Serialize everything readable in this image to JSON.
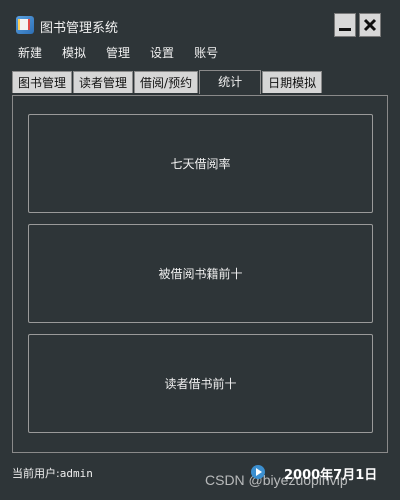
{
  "window": {
    "title": "图书管理系统",
    "minimize_icon": "minimize-icon",
    "close_icon": "close-icon"
  },
  "menubar": {
    "items": [
      "新建",
      "模拟",
      "管理",
      "设置",
      "账号"
    ]
  },
  "tabs": [
    {
      "label": "图书管理",
      "active": false
    },
    {
      "label": "读者管理",
      "active": false
    },
    {
      "label": "借阅/预约",
      "active": false
    },
    {
      "label": "统计",
      "active": true
    },
    {
      "label": "日期模拟",
      "active": false
    }
  ],
  "stats": {
    "buttons": [
      "七天借阅率",
      "被借阅书籍前十",
      "读者借书前十"
    ]
  },
  "status": {
    "user_label": "当前用户:",
    "user_name": "admin",
    "date": "2000年7月1日",
    "watermark": "CSDN @biyezuopinvip"
  },
  "colors": {
    "background": "#2e3538",
    "tab_inactive": "#d6d6d6",
    "border": "#8a8a8a",
    "accent": "#3c8fcf"
  }
}
